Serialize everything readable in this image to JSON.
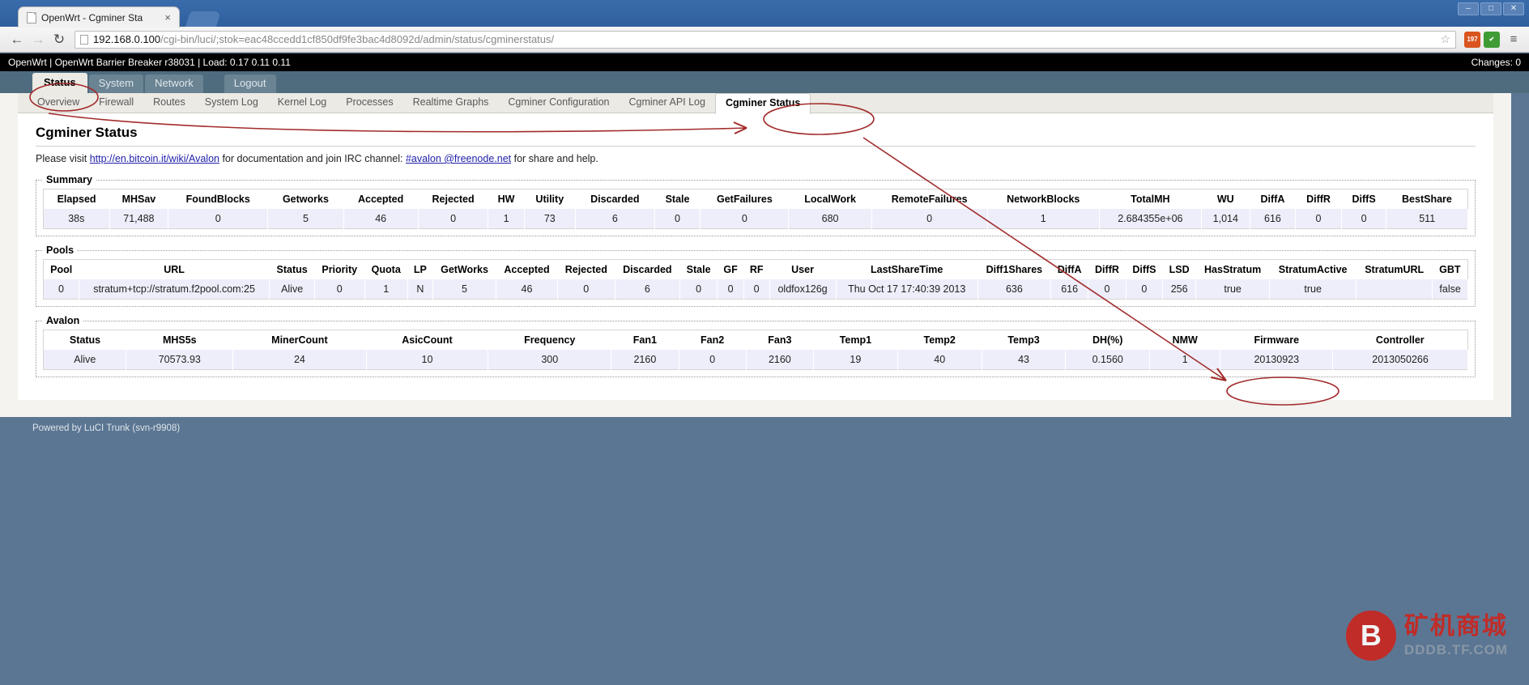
{
  "browser": {
    "tab_title": "OpenWrt - Cgminer Sta",
    "tab_close": "×",
    "back_icon": "←",
    "forward_icon": "→",
    "reload_icon": "↻",
    "url_host": "192.168.0.100",
    "url_rest": "/cgi-bin/luci/;stok=eac48ccedd1cf850df9fe3bac4d8092d/admin/status/cgminerstatus/",
    "star_icon": "☆",
    "ext1_label": "197",
    "ext2_label": "✔",
    "menu_icon": "≡",
    "win_minimize": "–",
    "win_maximize": "□",
    "win_close": "✕"
  },
  "luci": {
    "header_left": "OpenWrt | OpenWrt Barrier Breaker r38031 | Load: 0.17 0.11 0.11",
    "header_right": "Changes: 0",
    "main_tabs": [
      {
        "label": "Status",
        "active": true
      },
      {
        "label": "System",
        "active": false
      },
      {
        "label": "Network",
        "active": false
      },
      {
        "label": "Logout",
        "active": false
      }
    ],
    "sub_tabs": [
      {
        "label": "Overview",
        "active": false
      },
      {
        "label": "Firewall",
        "active": false
      },
      {
        "label": "Routes",
        "active": false
      },
      {
        "label": "System Log",
        "active": false
      },
      {
        "label": "Kernel Log",
        "active": false
      },
      {
        "label": "Processes",
        "active": false
      },
      {
        "label": "Realtime Graphs",
        "active": false
      },
      {
        "label": "Cgminer Configuration",
        "active": false
      },
      {
        "label": "Cgminer API Log",
        "active": false
      },
      {
        "label": "Cgminer Status",
        "active": true
      }
    ],
    "page_title": "Cgminer Status",
    "intro_pre": "Please visit ",
    "intro_link1": "http://en.bitcoin.it/wiki/Avalon",
    "intro_mid": " for documentation and join IRC channel: ",
    "intro_link2": "#avalon @freenode.net",
    "intro_post": " for share and help.",
    "footer": "Powered by LuCI Trunk (svn-r9908)"
  },
  "summary": {
    "legend": "Summary",
    "headers": [
      "Elapsed",
      "MHSav",
      "FoundBlocks",
      "Getworks",
      "Accepted",
      "Rejected",
      "HW",
      "Utility",
      "Discarded",
      "Stale",
      "GetFailures",
      "LocalWork",
      "RemoteFailures",
      "NetworkBlocks",
      "TotalMH",
      "WU",
      "DiffA",
      "DiffR",
      "DiffS",
      "BestShare"
    ],
    "rows": [
      [
        "38s",
        "71,488",
        "0",
        "5",
        "46",
        "0",
        "1",
        "73",
        "6",
        "0",
        "0",
        "680",
        "0",
        "1",
        "2.684355e+06",
        "1,014",
        "616",
        "0",
        "0",
        "511"
      ]
    ]
  },
  "pools": {
    "legend": "Pools",
    "headers": [
      "Pool",
      "URL",
      "Status",
      "Priority",
      "Quota",
      "LP",
      "GetWorks",
      "Accepted",
      "Rejected",
      "Discarded",
      "Stale",
      "GF",
      "RF",
      "User",
      "LastShareTime",
      "Diff1Shares",
      "DiffA",
      "DiffR",
      "DiffS",
      "LSD",
      "HasStratum",
      "StratumActive",
      "StratumURL",
      "GBT"
    ],
    "rows": [
      [
        "0",
        "stratum+tcp://stratum.f2pool.com:25",
        "Alive",
        "0",
        "1",
        "N",
        "5",
        "46",
        "0",
        "6",
        "0",
        "0",
        "0",
        "oldfox126g",
        "Thu Oct 17 17:40:39 2013",
        "636",
        "616",
        "0",
        "0",
        "256",
        "true",
        "true",
        "",
        "false"
      ]
    ]
  },
  "avalon": {
    "legend": "Avalon",
    "headers": [
      "Status",
      "MHS5s",
      "MinerCount",
      "AsicCount",
      "Frequency",
      "Fan1",
      "Fan2",
      "Fan3",
      "Temp1",
      "Temp2",
      "Temp3",
      "DH(%)",
      "NMW",
      "Firmware",
      "Controller"
    ],
    "rows": [
      [
        "Alive",
        "70573.93",
        "24",
        "10",
        "300",
        "2160",
        "0",
        "2160",
        "19",
        "40",
        "43",
        "0.1560",
        "1",
        "20130923",
        "2013050266"
      ]
    ]
  },
  "watermark": {
    "badge": "B",
    "cn": "矿机商城",
    "en": "DDDB.TF.COM"
  },
  "annotations": {
    "accent": "#a32b2b",
    "items": [
      {
        "name": "ellipse-status-tab"
      },
      {
        "name": "ellipse-cgminer-status-tab"
      },
      {
        "name": "ellipse-firmware-cell"
      },
      {
        "name": "arrow-to-cgminer-status-tab"
      },
      {
        "name": "arrow-to-firmware-cell"
      }
    ]
  }
}
